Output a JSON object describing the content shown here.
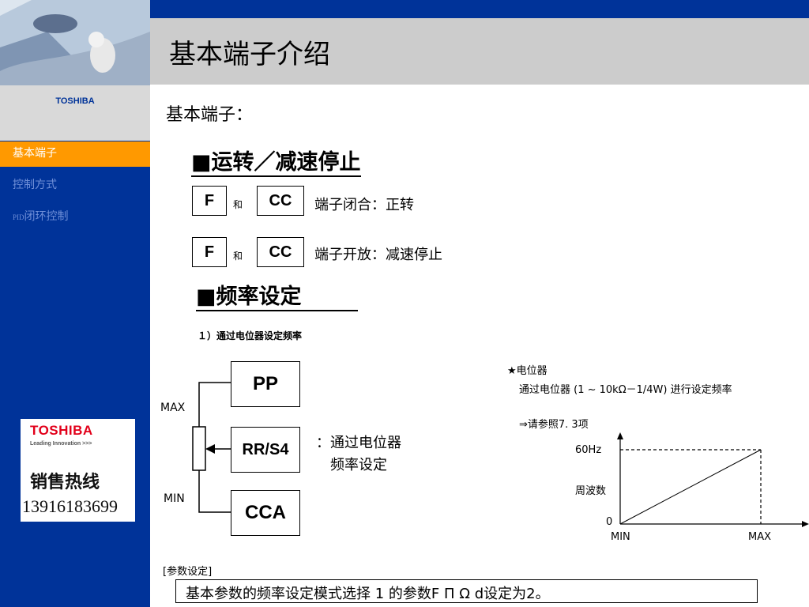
{
  "sidebar": {
    "brand": "TOSHIBA",
    "nav": [
      {
        "label": "基本端子",
        "active": true
      },
      {
        "label": "控制方式",
        "active": false
      },
      {
        "label_prefix": "PID",
        "label": "闭环控制",
        "active": false
      }
    ],
    "hotline": {
      "brand": "TOSHIBA",
      "tagline": "Leading Innovation >>>",
      "title": "销售热线",
      "phone": "13916183699"
    }
  },
  "header": {
    "title": "基本端子介绍"
  },
  "content": {
    "subtitle": "基本端子：",
    "section1": {
      "heading": "■运转／减速停止",
      "rows": [
        {
          "key1": "F",
          "and": "和",
          "key2": "CC",
          "text": "端子闭合：正转"
        },
        {
          "key1": "F",
          "and": "和",
          "key2": "CC",
          "text": "端子开放：减速停止"
        }
      ]
    },
    "section2": {
      "heading": "■频率设定",
      "step": "１）通过电位器设定频率",
      "diagram": {
        "max": "MAX",
        "min": "MIN",
        "terminals": [
          "PP",
          "RR/S4",
          "CCA"
        ],
        "desc_line1": "：通过电位器",
        "desc_line2": "频率设定"
      },
      "note": {
        "title": "★电位器",
        "line": "通过电位器 (1 ~ 10kΩ－1/4W) 进行设定频率",
        "ref": "⇒请参照7. 3项"
      },
      "graph": {
        "y_top": "60Hz",
        "y_label": "周波数",
        "origin": "0",
        "x_min": "MIN",
        "x_max": "MAX"
      }
    },
    "param_label": "[参数设定]",
    "param_text": "基本参数的频率设定模式选择 1 的参数F Π Ω d设定为2。"
  },
  "colors": {
    "sidebar": "#003399",
    "active": "#ff9900",
    "header": "#cccccc"
  }
}
